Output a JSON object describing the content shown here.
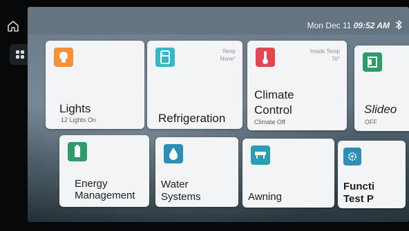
{
  "status": {
    "date": "Mon Dec 11",
    "time": "09:52 AM"
  },
  "tiles": {
    "lights": {
      "title": "Lights",
      "subtitle": "12 Lights On",
      "color": "#f2913a"
    },
    "refrigeration": {
      "title": "Refrigeration",
      "corner_label": "Temp",
      "corner_value": "None°",
      "color": "#34b7c9"
    },
    "climate": {
      "title_line1": "Climate",
      "title_line2": "Control",
      "subtitle": "Climate Off",
      "corner_label": "Inside Temp",
      "corner_value": "70°",
      "color": "#e2464f"
    },
    "slideouts": {
      "title": "Slideo",
      "subtitle": "OFF",
      "color": "#2f9b6a"
    },
    "energy": {
      "title_line1": "Energy",
      "title_line2": "Management",
      "color": "#2f9b6a"
    },
    "water": {
      "title_line1": "Water",
      "title_line2": "Systems",
      "color": "#2b8fb7"
    },
    "awning": {
      "title": "Awning",
      "color": "#2a9db7"
    },
    "function": {
      "title_line1": "Functi",
      "title_line2": "Test P",
      "color": "#2b8fb7"
    }
  },
  "icons": [
    "home-icon",
    "grid-icon",
    "bell-icon",
    "gear-icon",
    "message-icon",
    "bluetooth-icon",
    "bulb-icon",
    "fridge-icon",
    "thermometer-icon",
    "slideout-icon",
    "battery-icon",
    "water-drop-icon",
    "awning-icon",
    "settings-icon"
  ]
}
